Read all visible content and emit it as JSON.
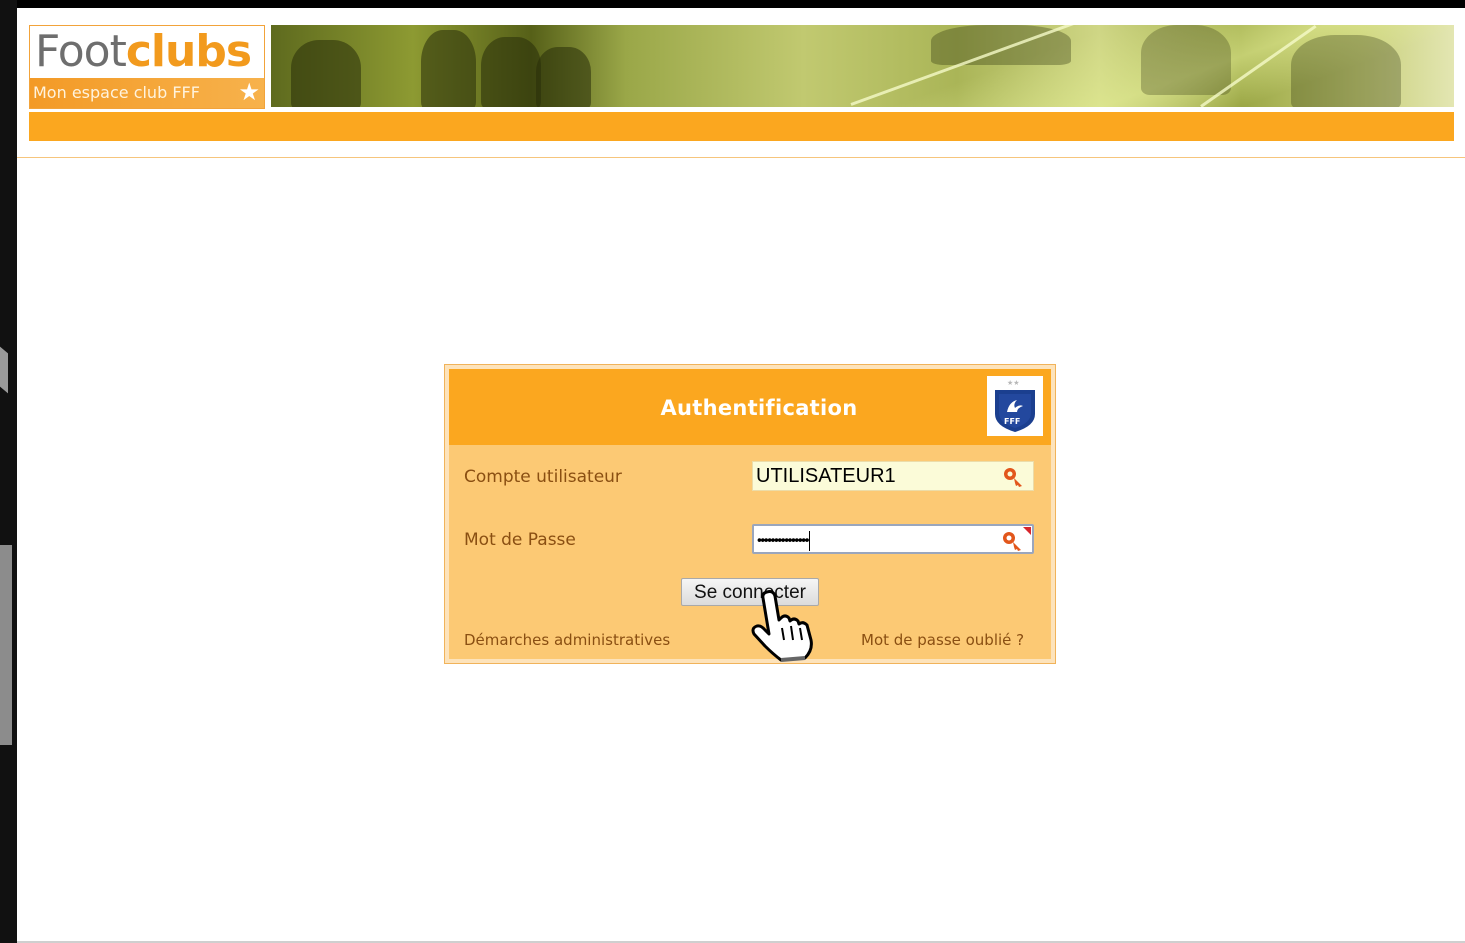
{
  "logo": {
    "foot": "Foot",
    "clubs": "clubs",
    "subtitle": "Mon espace club FFF"
  },
  "auth": {
    "title": "Authentification",
    "user_label": "Compte utilisateur",
    "user_value": "UTILISATEUR1",
    "password_label": "Mot de Passe",
    "password_mask": "•••••••••••••••",
    "connect_label": "Se connecter",
    "admin_link": "Démarches administratives",
    "forgot_link": "Mot de passe oublié ?"
  },
  "badge": {
    "text": "FFF"
  },
  "colors": {
    "orange": "#fba71f",
    "panel": "#fcc974",
    "label": "#8a4f12"
  },
  "icons": [
    "key-icon",
    "fff-logo-icon",
    "hand-pointer-cursor-icon",
    "star-icon"
  ]
}
